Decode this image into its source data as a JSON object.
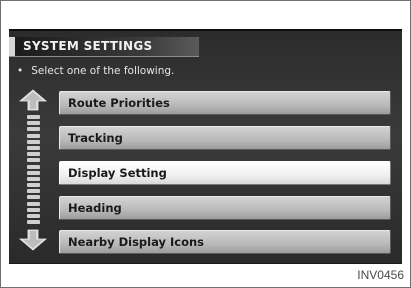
{
  "header": {
    "title": "SYSTEM SETTINGS",
    "instruction_bullet": "•",
    "instruction": "Select one of the following."
  },
  "menu": {
    "items": [
      {
        "label": "Route Priorities",
        "selected": false
      },
      {
        "label": "Tracking",
        "selected": false
      },
      {
        "label": "Display Setting",
        "selected": true
      },
      {
        "label": "Heading",
        "selected": false
      },
      {
        "label": "Nearby Display Icons",
        "selected": false
      }
    ]
  },
  "scroll": {
    "up_icon": "arrow-up-icon",
    "down_icon": "arrow-down-icon"
  },
  "footer": {
    "figure_code": "INV0456"
  },
  "colors": {
    "screen_bg": "#333333",
    "button": "#c4c4c4",
    "button_selected": "#f4f4f4",
    "text_light": "#f2f2f2",
    "text_dark": "#1a1a1a"
  }
}
